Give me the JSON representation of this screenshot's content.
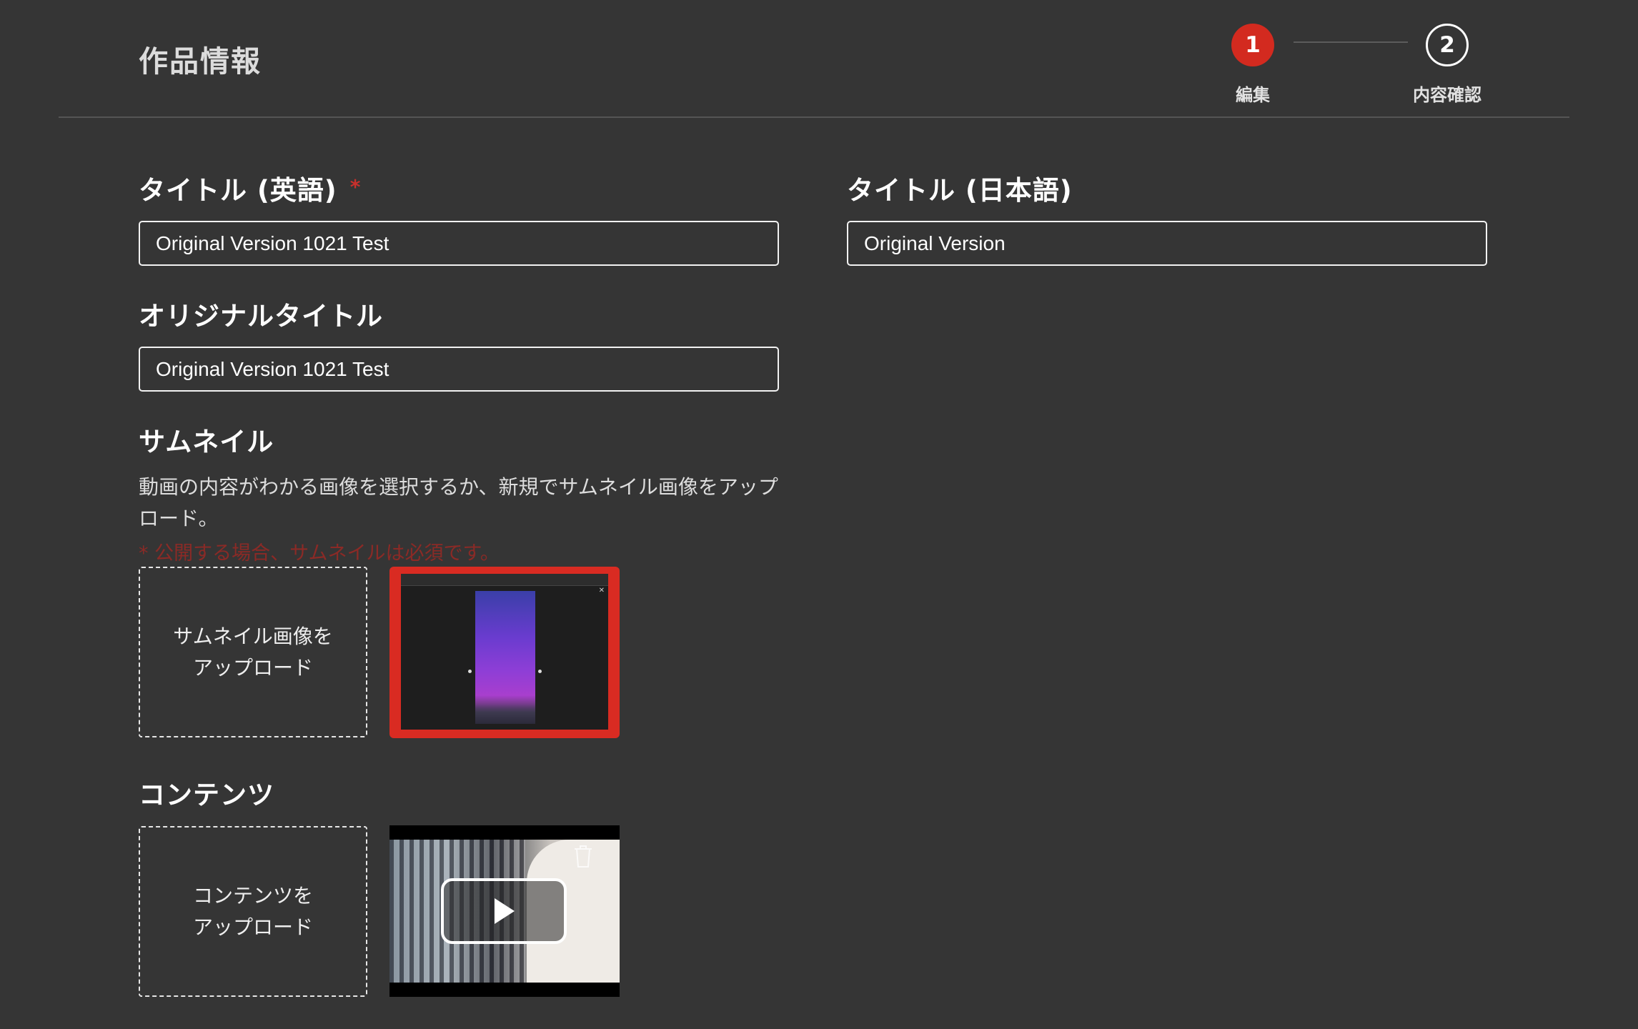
{
  "header": {
    "title": "作品情報",
    "steps": [
      {
        "number": "1",
        "label": "編集",
        "active": true
      },
      {
        "number": "2",
        "label": "内容確認",
        "active": false
      }
    ]
  },
  "form": {
    "title_en": {
      "label": "タイトル (英語)",
      "required_mark": "*",
      "value": "Original Version 1021 Test"
    },
    "title_ja": {
      "label": "タイトル (日本語)",
      "value": "Original Version"
    },
    "original_title": {
      "label": "オリジナルタイトル",
      "value": "Original Version 1021 Test"
    },
    "thumbnail": {
      "label": "サムネイル",
      "help": "動画の内容がわかる画像を選択するか、新規でサムネイル画像をアップロード。",
      "required_note": "* 公開する場合、サムネイルは必須です。",
      "upload_line1": "サムネイル画像を",
      "upload_line2": "アップロード"
    },
    "contents": {
      "label": "コンテンツ",
      "upload_line1": "コンテンツを",
      "upload_line2": "アップロード"
    }
  },
  "colors": {
    "background": "#353535",
    "accent": "#d32a1f",
    "required": "#c9302c"
  },
  "icons": [
    "play-icon",
    "trash-icon"
  ]
}
